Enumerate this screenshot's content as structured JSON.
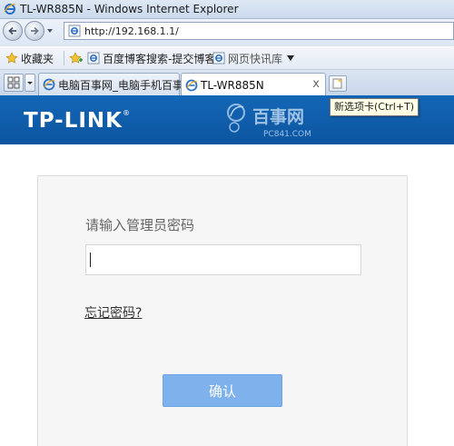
{
  "window": {
    "title": "TL-WR885N - Windows Internet Explorer"
  },
  "navigation": {
    "address": "http://192.168.1.1/"
  },
  "favorites_bar": {
    "favorites_label": "收藏夹",
    "items": [
      {
        "label": "百度博客搜索-提交博客"
      },
      {
        "label": "网页快讯库"
      }
    ]
  },
  "tabs": {
    "items": [
      {
        "label": "电脑百事网_电脑手机百事网"
      },
      {
        "label": "TL-WR885N"
      }
    ],
    "close_symbol": "x",
    "new_tab_tooltip": "新选项卡(Ctrl+T)"
  },
  "header": {
    "brand": "TP-LINK",
    "brand_mark": "®",
    "watermark_text": "百事网",
    "watermark_sub": "PC841.COM"
  },
  "login": {
    "prompt": "请输入管理员密码",
    "password_value": "",
    "forgot_password": "忘记密码?",
    "confirm_label": "确认"
  },
  "colors": {
    "header_blue": "#1366b6",
    "button_blue": "#7fb2ec",
    "panel_gray": "#f6f6f6"
  }
}
